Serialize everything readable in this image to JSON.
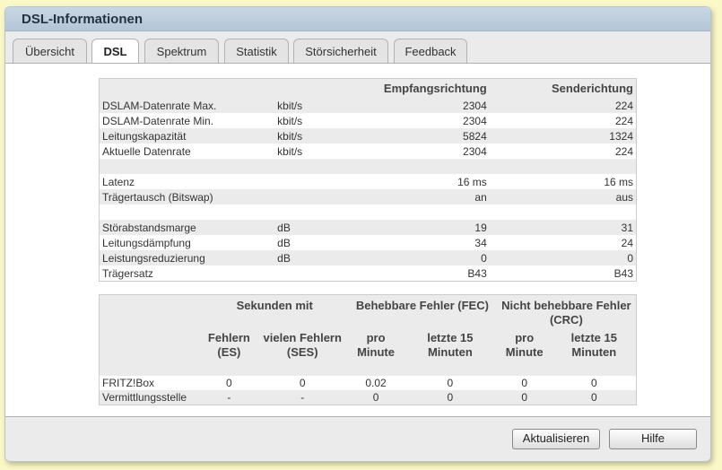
{
  "window": {
    "title": "DSL-Informationen"
  },
  "tabs": [
    {
      "label": "Übersicht"
    },
    {
      "label": "DSL"
    },
    {
      "label": "Spektrum"
    },
    {
      "label": "Statistik"
    },
    {
      "label": "Störsicherheit"
    },
    {
      "label": "Feedback"
    }
  ],
  "rates": {
    "headers": {
      "downstream": "Empfangsrichtung",
      "upstream": "Senderichtung"
    },
    "rows": [
      {
        "label": "DSLAM-Datenrate Max.",
        "unit": "kbit/s",
        "down": "2304",
        "up": "224"
      },
      {
        "label": "DSLAM-Datenrate Min.",
        "unit": "kbit/s",
        "down": "2304",
        "up": "224"
      },
      {
        "label": "Leitungskapazität",
        "unit": "kbit/s",
        "down": "5824",
        "up": "1324"
      },
      {
        "label": "Aktuelle Datenrate",
        "unit": "kbit/s",
        "down": "2304",
        "up": "224"
      },
      {
        "label": "",
        "unit": "",
        "down": "",
        "up": ""
      },
      {
        "label": "Latenz",
        "unit": "",
        "down": "16 ms",
        "up": "16 ms"
      },
      {
        "label": "Trägertausch (Bitswap)",
        "unit": "",
        "down": "an",
        "up": "aus"
      },
      {
        "label": "",
        "unit": "",
        "down": "",
        "up": ""
      },
      {
        "label": "Störabstandsmarge",
        "unit": "dB",
        "down": "19",
        "up": "31"
      },
      {
        "label": "Leitungsdämpfung",
        "unit": "dB",
        "down": "34",
        "up": "24"
      },
      {
        "label": "Leistungsreduzierung",
        "unit": "dB",
        "down": "0",
        "up": "0"
      },
      {
        "label": "Trägersatz",
        "unit": "",
        "down": "B43",
        "up": "B43"
      }
    ]
  },
  "errors": {
    "group_headers": {
      "seconds": "Sekunden mit",
      "fec": "Behebbare Fehler (FEC)",
      "crc": "Nicht behebbare Fehler (CRC)"
    },
    "sub_headers": {
      "es": "Fehlern (ES)",
      "ses": "vielen Fehlern (SES)",
      "fec_min": "pro Minute",
      "fec_15": "letzte 15 Minuten",
      "crc_min": "pro Minute",
      "crc_15": "letzte 15 Minuten"
    },
    "rows": [
      {
        "label": "FRITZ!Box",
        "es": "0",
        "ses": "0",
        "fec_min": "0.02",
        "fec_15": "0",
        "crc_min": "0",
        "crc_15": "0"
      },
      {
        "label": "Vermittlungsstelle",
        "es": "-",
        "ses": "-",
        "fec_min": "0",
        "fec_15": "0",
        "crc_min": "0",
        "crc_15": "0"
      }
    ]
  },
  "buttons": {
    "refresh": "Aktualisieren",
    "help": "Hilfe"
  }
}
